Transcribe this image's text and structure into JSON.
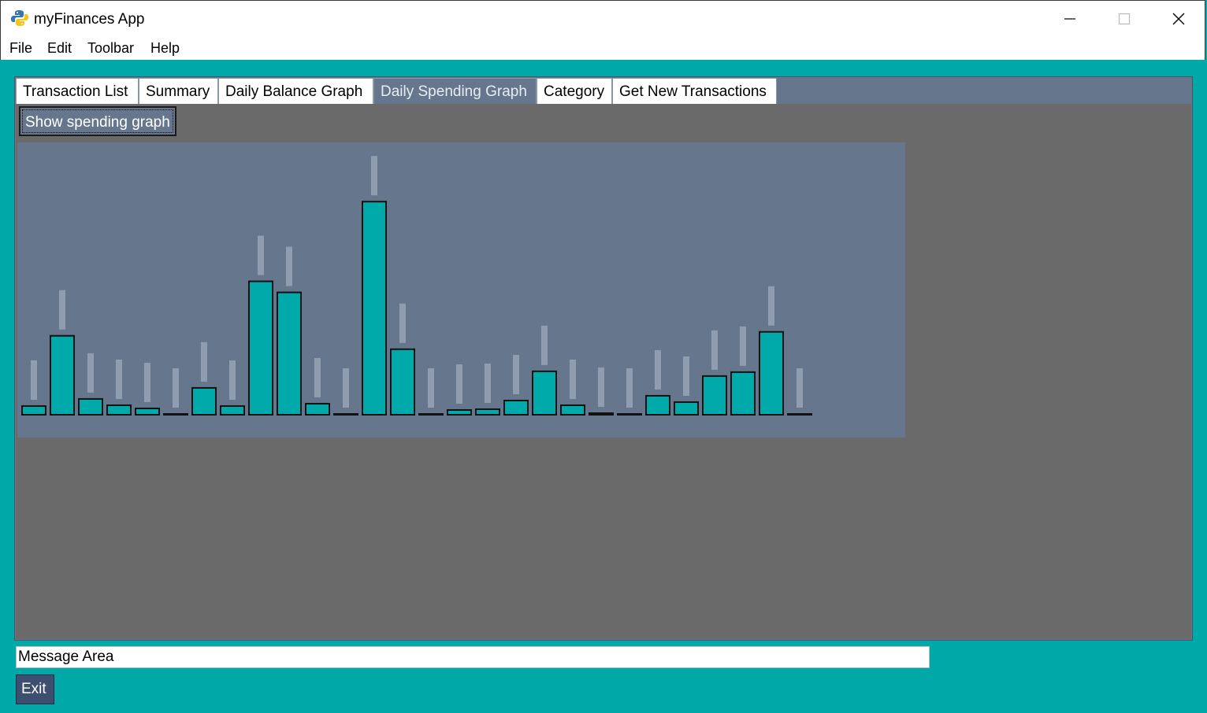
{
  "window": {
    "title": "myFinances App"
  },
  "menu": [
    "File",
    "Edit",
    "Toolbar",
    "Help"
  ],
  "tabs": [
    {
      "label": "Transaction List",
      "active": false
    },
    {
      "label": "Summary",
      "active": false
    },
    {
      "label": "Daily Balance Graph",
      "active": false
    },
    {
      "label": "Daily Spending Graph",
      "active": true
    },
    {
      "label": "Category",
      "active": false
    },
    {
      "label": "Get New Transactions",
      "active": false
    }
  ],
  "panel": {
    "show_button": "Show spending graph"
  },
  "message_area": "Message Area",
  "exit_label": "Exit",
  "colors": {
    "accent": "#00a8a8",
    "panel": "#6a6a6a",
    "chart_bg": "#66778d",
    "bar": "#00aaaa",
    "button": "#3c4f70"
  },
  "chart_data": {
    "type": "bar",
    "values": [
      11,
      100,
      20,
      12,
      8,
      0,
      34,
      11,
      169,
      155,
      14,
      0,
      270,
      83,
      0,
      6,
      7,
      18,
      55,
      12,
      2,
      0,
      24,
      16,
      49,
      54,
      105,
      0
    ],
    "ylim": [
      0,
      345
    ]
  }
}
